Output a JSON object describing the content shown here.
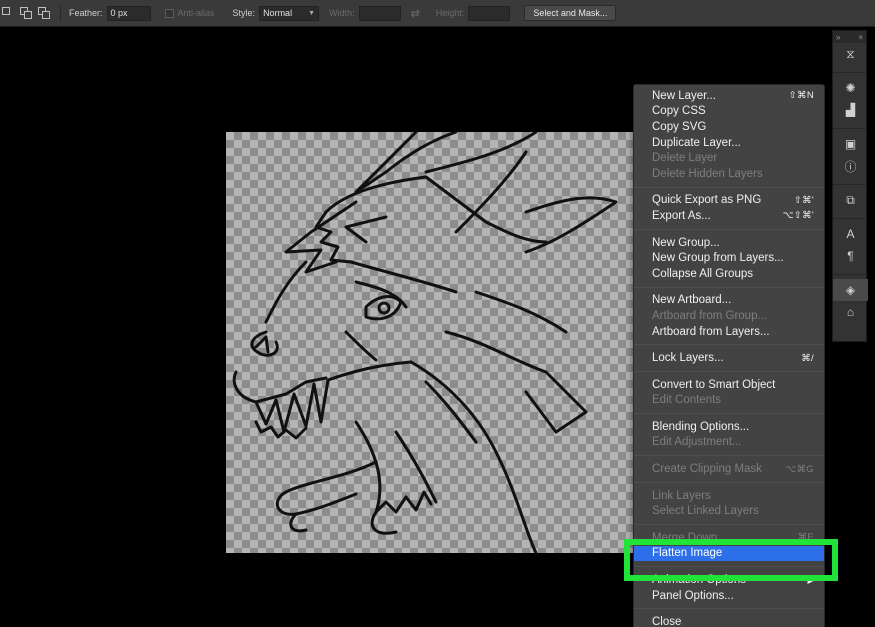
{
  "options_bar": {
    "feather_label": "Feather:",
    "feather_value": "0 px",
    "anti_alias_label": "Anti-alias",
    "style_label": "Style:",
    "style_value": "Normal",
    "width_label": "Width:",
    "height_label": "Height:",
    "select_mask_label": "Select and Mask..."
  },
  "context_menu": {
    "groups": [
      [
        {
          "label": "New Layer...",
          "shortcut": "⇧⌘N",
          "disabled": false
        },
        {
          "label": "Copy CSS",
          "shortcut": "",
          "disabled": false
        },
        {
          "label": "Copy SVG",
          "shortcut": "",
          "disabled": false
        },
        {
          "label": "Duplicate Layer...",
          "shortcut": "",
          "disabled": false
        },
        {
          "label": "Delete Layer",
          "shortcut": "",
          "disabled": true
        },
        {
          "label": "Delete Hidden Layers",
          "shortcut": "",
          "disabled": true
        }
      ],
      [
        {
          "label": "Quick Export as PNG",
          "shortcut": "⇧⌘'",
          "disabled": false
        },
        {
          "label": "Export As...",
          "shortcut": "⌥⇧⌘'",
          "disabled": false
        }
      ],
      [
        {
          "label": "New Group...",
          "shortcut": "",
          "disabled": false
        },
        {
          "label": "New Group from Layers...",
          "shortcut": "",
          "disabled": false
        },
        {
          "label": "Collapse All Groups",
          "shortcut": "",
          "disabled": false
        }
      ],
      [
        {
          "label": "New Artboard...",
          "shortcut": "",
          "disabled": false
        },
        {
          "label": "Artboard from Group...",
          "shortcut": "",
          "disabled": true
        },
        {
          "label": "Artboard from Layers...",
          "shortcut": "",
          "disabled": false
        }
      ],
      [
        {
          "label": "Lock Layers...",
          "shortcut": "⌘/",
          "disabled": false
        }
      ],
      [
        {
          "label": "Convert to Smart Object",
          "shortcut": "",
          "disabled": false
        },
        {
          "label": "Edit Contents",
          "shortcut": "",
          "disabled": true
        }
      ],
      [
        {
          "label": "Blending Options...",
          "shortcut": "",
          "disabled": false
        },
        {
          "label": "Edit Adjustment...",
          "shortcut": "",
          "disabled": true
        }
      ],
      [
        {
          "label": "Create Clipping Mask",
          "shortcut": "⌥⌘G",
          "disabled": true
        }
      ],
      [
        {
          "label": "Link Layers",
          "shortcut": "",
          "disabled": true
        },
        {
          "label": "Select Linked Layers",
          "shortcut": "",
          "disabled": true
        }
      ],
      [
        {
          "label": "Merge Down",
          "shortcut": "⌘E",
          "disabled": true
        },
        {
          "label": "Flatten Image",
          "shortcut": "",
          "disabled": false,
          "highlighted": true
        }
      ],
      [
        {
          "label": "Animation Options",
          "shortcut": "▶",
          "disabled": false
        },
        {
          "label": "Panel Options...",
          "shortcut": "",
          "disabled": false
        }
      ],
      [
        {
          "label": "Close",
          "shortcut": "",
          "disabled": false
        }
      ]
    ]
  },
  "colors": {
    "menu_bg": "#434343",
    "highlight": "#2c6fe8",
    "annotation_box": "#22e33a"
  }
}
